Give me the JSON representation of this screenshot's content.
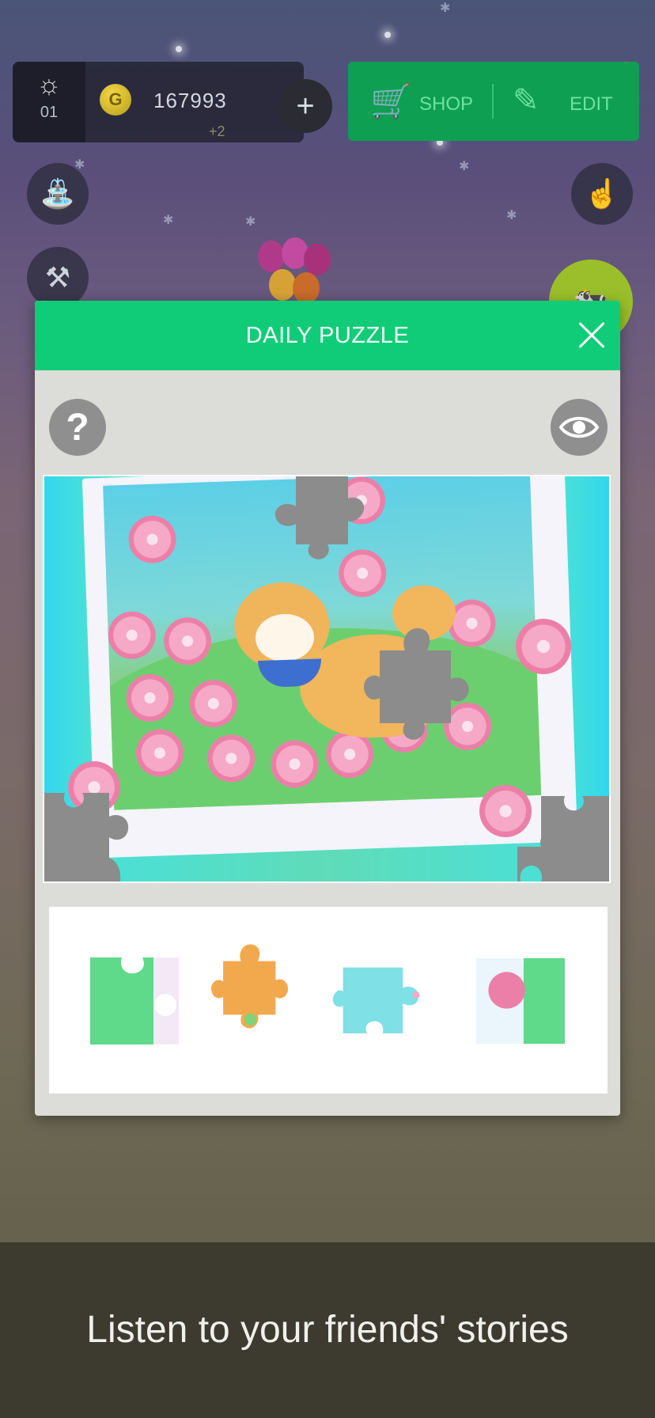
{
  "hud": {
    "level": "01",
    "coins": "167993",
    "coins_delta": "+2",
    "plus_label": "+",
    "shop_label": "SHOP",
    "edit_label": "EDIT"
  },
  "side_buttons": {
    "left": [
      "watering-can-icon",
      "scythe-icon"
    ],
    "right": [
      "tap-hand-icon",
      "animal-avatar-icon"
    ]
  },
  "dialog": {
    "title": "DAILY PUZZLE",
    "close_icon": "close-icon",
    "help_label": "?",
    "preview_icon": "eye-icon",
    "image_subject": "shiba dog among cherry blossoms",
    "pieces": [
      "piece-1",
      "piece-2",
      "piece-3",
      "piece-4"
    ]
  },
  "colors": {
    "accent": "#10cc78",
    "hud_green": "#0f9f52",
    "missing_piece": "#8c8c8c"
  },
  "footer": {
    "caption": "Listen to your friends' stories"
  }
}
